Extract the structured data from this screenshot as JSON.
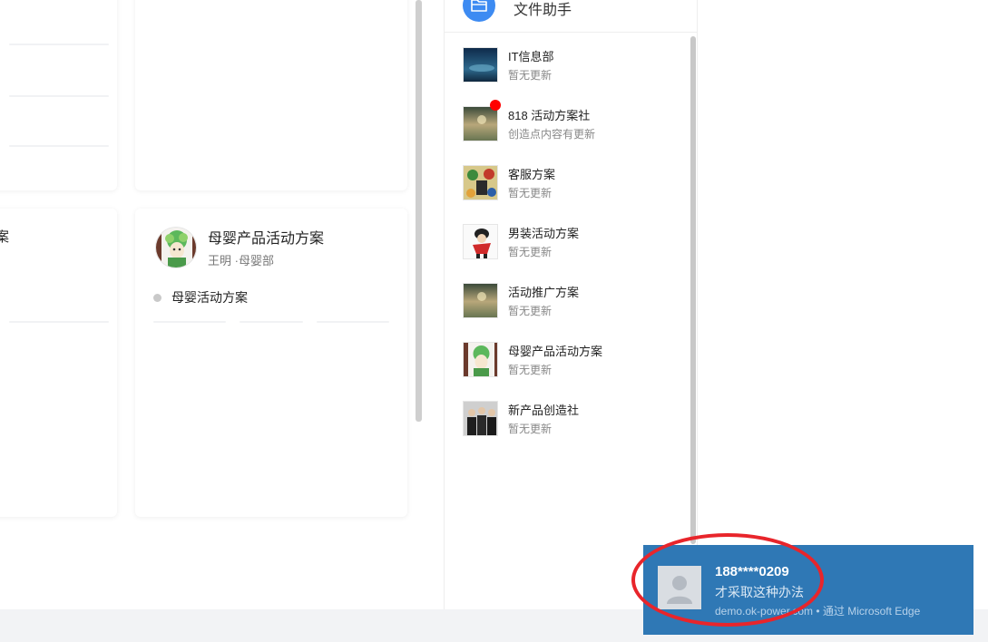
{
  "side_panel": {
    "header_title": "文件助手",
    "conversations": [
      {
        "name": "IT信息部",
        "status": "暂无更新",
        "thumb_icon": "night-sky-thumbnail",
        "unread": false
      },
      {
        "name": "818 活动方案社",
        "status": "创造点内容有更新",
        "thumb_icon": "landscape-thumbnail",
        "unread": true
      },
      {
        "name": "客服方案",
        "status": "暂无更新",
        "thumb_icon": "cartoon-thumbnail",
        "unread": false
      },
      {
        "name": "男装活动方案",
        "status": "暂无更新",
        "thumb_icon": "cartoon-character-thumbnail",
        "unread": false
      },
      {
        "name": "活动推广方案",
        "status": "暂无更新",
        "thumb_icon": "landscape-thumbnail",
        "unread": false
      },
      {
        "name": "母婴产品活动方案",
        "status": "暂无更新",
        "thumb_icon": "plant-head-avatar-thumbnail",
        "unread": false
      },
      {
        "name": "新产品创造社",
        "status": "暂无更新",
        "thumb_icon": "group-photo-thumbnail",
        "unread": false
      }
    ]
  },
  "cards": {
    "partial_title": "案",
    "muying": {
      "title": "母婴产品活动方案",
      "author": "王明 ·母婴部",
      "plan_item": "母婴活动方案"
    }
  },
  "toast": {
    "title": "188****0209",
    "body": "才采取这种办法",
    "source": "demo.ok-power.com • 通过 Microsoft Edge"
  },
  "colors": {
    "accent_blue": "#3d8bf2",
    "toast_bg": "#2f78b5",
    "unread_dot": "#ff0000",
    "annotation_ellipse": "#e8252b"
  }
}
